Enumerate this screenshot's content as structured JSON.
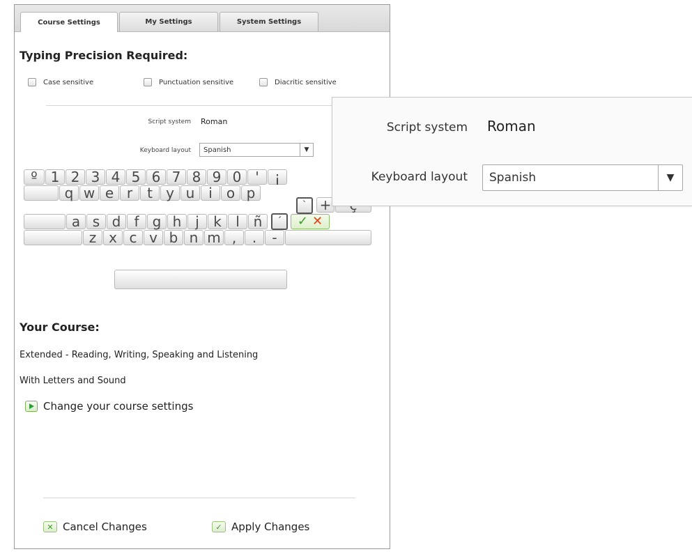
{
  "tabs": [
    "Course Settings",
    "My Settings",
    "System Settings"
  ],
  "typing": {
    "heading": "Typing Precision Required:",
    "options": [
      "Case sensitive",
      "Punctuation sensitive",
      "Diacritic sensitive"
    ]
  },
  "fields": {
    "script_label": "Script system",
    "script_value": "Roman",
    "keyboard_label": "Keyboard layout",
    "keyboard_value": "Spanish"
  },
  "keyboard": {
    "row1": [
      "º",
      "1",
      "2",
      "3",
      "4",
      "5",
      "6",
      "7",
      "8",
      "9",
      "0",
      "'",
      "¡"
    ],
    "row2": [
      "q",
      "w",
      "e",
      "r",
      "t",
      "y",
      "u",
      "i",
      "o",
      "p",
      "`",
      "+",
      "ç"
    ],
    "row3": [
      "a",
      "s",
      "d",
      "f",
      "g",
      "h",
      "j",
      "k",
      "l",
      "ñ",
      "´"
    ],
    "row4": [
      "z",
      "x",
      "c",
      "v",
      "b",
      "n",
      "m",
      ",",
      ".",
      "-"
    ],
    "ok_symbol": "✓",
    "cancel_symbol": "✕"
  },
  "course": {
    "heading": "Your Course:",
    "line1": "Extended - Reading, Writing, Speaking and Listening",
    "line2": "With Letters and Sound",
    "change_link": "Change your course settings"
  },
  "actions": {
    "cancel": "Cancel Changes",
    "apply": "Apply Changes"
  },
  "colors": {
    "accent_green": "#3c9b2b",
    "cancel_red": "#d9461e"
  }
}
